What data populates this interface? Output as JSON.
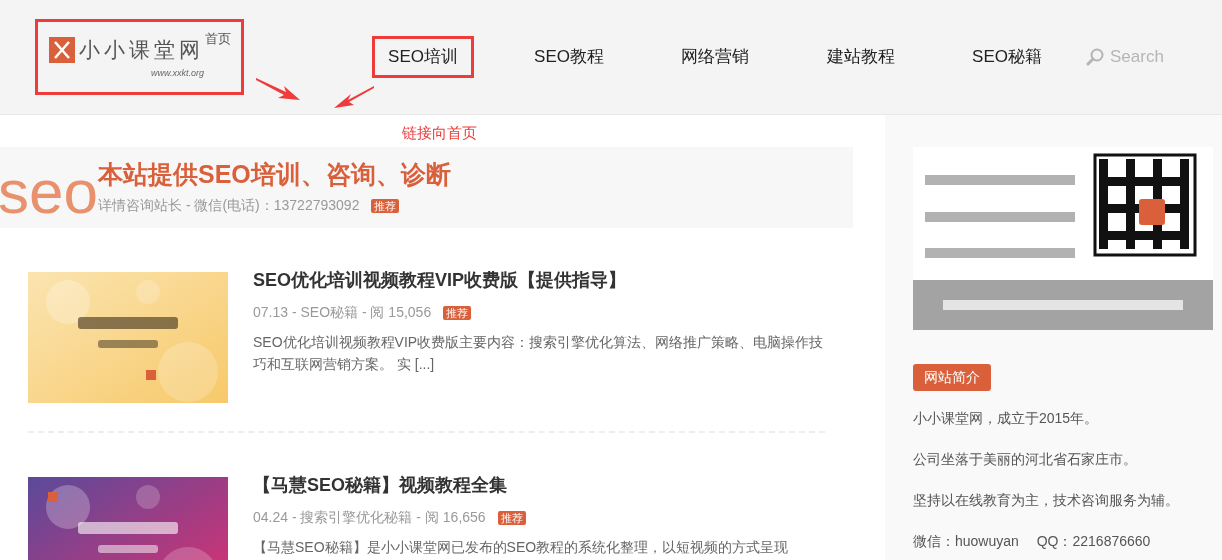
{
  "header": {
    "logo": {
      "name": "小小课堂网",
      "url": "www.xxkt.org"
    },
    "annotation_logo": "首页",
    "nav": [
      {
        "label": "SEO培训",
        "selected": true
      },
      {
        "label": "SEO教程",
        "selected": false
      },
      {
        "label": "网络营销",
        "selected": false
      },
      {
        "label": "建站教程",
        "selected": false
      },
      {
        "label": "SEO秘籍",
        "selected": false
      }
    ],
    "search": {
      "placeholder": "Search"
    },
    "annotation": "链接向首页"
  },
  "promo": {
    "watermark": "seo",
    "title": "本站提供SEO培训、咨询、诊断",
    "subtitle": "详情咨询站长 - 微信(电话)：13722793092",
    "badge": "推荐"
  },
  "posts": [
    {
      "title": "SEO优化培训视频教程VIP收费版【提供指导】",
      "meta": "07.13 - SEO秘籍 - 阅 15,056",
      "badge": "推荐",
      "excerpt": "SEO优化培训视频教程VIP收费版主要内容：搜索引擎优化算法、网络推广策略、电脑操作技巧和互联网营销方案。 实 [...]"
    },
    {
      "title": "【马慧SEO秘籍】视频教程全集",
      "meta": "04.24 - 搜索引擎优化秘籍 - 阅 16,656",
      "badge": "推荐",
      "excerpt": "【马慧SEO秘籍】是小小课堂网已发布的SEO教程的系统化整理，以短视频的方式呈现"
    }
  ],
  "sidebar": {
    "section_title": "网站简介",
    "lines": [
      "小小课堂网，成立于2015年。",
      "公司坐落于美丽的河北省石家庄市。",
      "坚持以在线教育为主，技术咨询服务为辅。",
      "微信：huowuyan　 QQ：2216876660"
    ]
  }
}
